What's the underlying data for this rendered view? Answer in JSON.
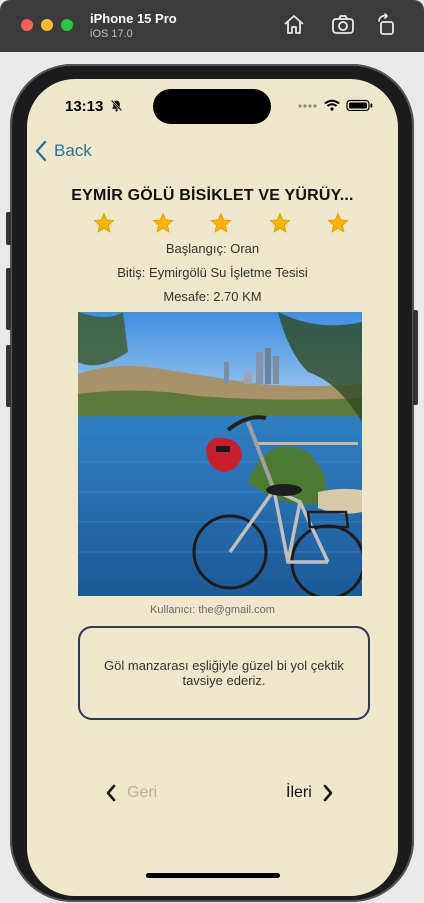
{
  "simulator": {
    "device_name": "iPhone 15 Pro",
    "os_version": "iOS 17.0",
    "toolbar_icons": [
      "home-icon",
      "screenshot-icon",
      "rotate-icon"
    ]
  },
  "status_bar": {
    "time": "13:13",
    "icons": [
      "bell-slash-icon",
      "signal-dots-icon",
      "wifi-icon",
      "battery-icon"
    ]
  },
  "navigation": {
    "back_label": "Back"
  },
  "route": {
    "title": "EYMİR GÖLÜ BİSİKLET VE YÜRÜY...",
    "rating": 5,
    "rating_max": 5,
    "start": "Başlangıç: Oran",
    "end": "Bitiş: Eymirgölü Su İşletme Tesisi",
    "distance": "Mesafe: 2.70 KM",
    "user": "Kullanıcı: the@gmail.com",
    "comment": "Göl manzarası eşliğiyle güzel bi yol çektik tavsiye ederiz."
  },
  "pager": {
    "prev_label": "Geri",
    "next_label": "İleri"
  },
  "colors": {
    "background": "#efe7cb",
    "accent": "#2e6f9e",
    "star": "#f4b400",
    "box_border": "#2b3a55"
  }
}
